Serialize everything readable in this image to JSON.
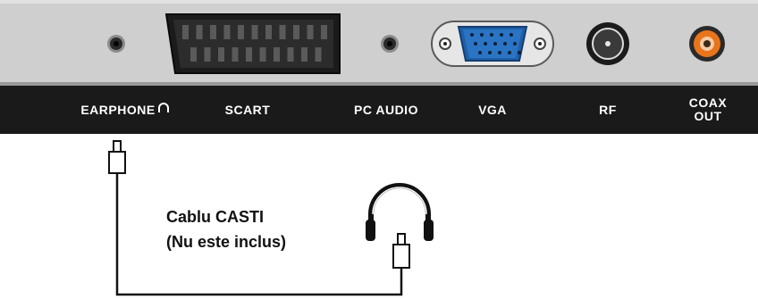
{
  "ports": {
    "earphone": "EARPHONE",
    "scart": "SCART",
    "pc_audio": "PC AUDIO",
    "vga": "VGA",
    "rf": "RF",
    "coax_line1": "COAX",
    "coax_line2": "OUT"
  },
  "annotation": {
    "cable_line1": "Cablu CASTI",
    "cable_line2": "(Nu este inclus)"
  },
  "colors": {
    "panel": "#cfcfcf",
    "label_bar": "#1a1a1a",
    "vga_blue": "#1f5fa8",
    "coax_orange": "#e8741c"
  },
  "icons": [
    "headphone-symbol-icon",
    "headphones-icon",
    "earphone-jack-icon",
    "scart-connector-icon",
    "pc-audio-jack-icon",
    "vga-connector-icon",
    "rf-connector-icon",
    "coax-connector-icon"
  ]
}
